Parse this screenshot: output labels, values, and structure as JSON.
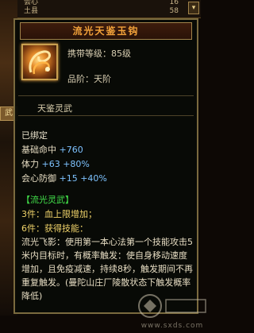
{
  "background": {
    "stats": [
      {
        "label": "会心",
        "value": "16"
      },
      {
        "label": "土县",
        "value": "58"
      }
    ],
    "left_tab": "武",
    "scroll_arrow": "▾"
  },
  "tooltip": {
    "title": "流光天鉴玉钩",
    "carry_level": "携带等级：85级",
    "quality": "品阶：天阶",
    "sub_name": "天鉴灵武",
    "bound": "已绑定",
    "stats": [
      {
        "label": "基础命中",
        "value": "+760",
        "extra": ""
      },
      {
        "label": "体力",
        "value": "+63",
        "extra": "+80%"
      },
      {
        "label": "会心防御",
        "value": "+15",
        "extra": "+40%"
      }
    ],
    "set_name": "【流光灵武】",
    "set_bonus_3": "3件：血上限增加；",
    "set_bonus_6": "6件：获得技能：",
    "skill_text": "流光飞影：使用第一本心法第一个技能攻击5米内目标时，有概率触发：使自身移动速度增加，且免疫减速，持续8秒，触发期间不再重复触发。(曼陀山庄厂陵散状态下触发概率降低)",
    "watermark": "www.sxds.com"
  },
  "colors": {
    "title": "#f2a23a",
    "border": "#7a6a3e",
    "blue": "#7ec3ff",
    "green": "#42e04a"
  }
}
